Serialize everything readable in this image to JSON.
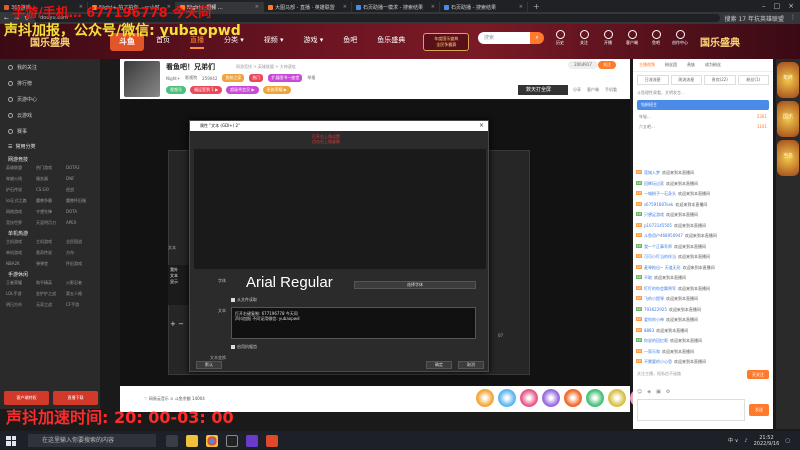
{
  "browser": {
    "tabs": [
      {
        "label": "365游戏…",
        "color": "#e05a2a"
      },
      {
        "label": "Night+ 拍了拍你… 一小时",
        "color": "#ff7a2a"
      },
      {
        "label": "Night+ 视频 …",
        "color": "#ff7a2a",
        "active": true
      },
      {
        "label": "大图马部 - 直播 · 英雄联盟",
        "color": "#ff7a2a"
      },
      {
        "label": "石页助播一模求 - 搜索结果",
        "color": "#4a8be8"
      },
      {
        "label": "石页助播 - 搜索结果",
        "color": "#4a8be8"
      }
    ],
    "plus": "+",
    "address": "douyu.com",
    "search_hint": "搜索 17 年抗英雄联盟"
  },
  "overlays": {
    "line1": "手游/手机…  677196778  今天同",
    "line2": "声抖加报，公众号/微信:  yubaopwd",
    "timer": "声抖加速时间: 20: 00-03: 00"
  },
  "site": {
    "logo": "斗鱼",
    "festival": "国乐盛典",
    "nav": [
      {
        "label": "首页"
      },
      {
        "label": "直播",
        "active": true
      },
      {
        "label": "分类 ▾"
      },
      {
        "label": "视频 ▾"
      },
      {
        "label": "游戏 ▾"
      },
      {
        "label": "鱼吧"
      },
      {
        "label": "鱼乐盛典"
      }
    ],
    "badge_line1": "年度国乐盛典",
    "badge_line2": "全民争霸赛",
    "search_placeholder": "搜索",
    "icons": [
      {
        "label": "历史"
      },
      {
        "label": "关注"
      },
      {
        "label": "开播"
      },
      {
        "label": "客户端"
      },
      {
        "label": "鱼吧"
      },
      {
        "label": "创作中心"
      }
    ]
  },
  "sidebar": {
    "items": [
      {
        "label": "我的关注"
      },
      {
        "label": "排行榜"
      },
      {
        "label": "页游中心"
      },
      {
        "label": "云游戏"
      },
      {
        "label": "赛事"
      }
    ],
    "section_common": "常用分类",
    "section_online": "网游竞技",
    "online_grid": [
      "英雄联盟",
      "热门游戏",
      "DOTA2",
      "穿越火线",
      "服务器",
      "DNF",
      "炉石传说",
      "CS:GO",
      "逆战",
      "lol正式之路",
      "魔兽争霸",
      "魔兽怀旧服",
      "网络游戏",
      "守望先锋",
      "DOTA",
      "竞技世界",
      "天涯明月刀",
      "APEX"
    ],
    "section_single": "单机热游",
    "single_grid": [
      "主机游戏",
      "主机游戏",
      "全民国战",
      "单机游戏",
      "奥奇传说",
      "方舟",
      "NBA2K",
      "弹弹堂",
      "怀旧游戏"
    ],
    "section_mobile": "手游休闲",
    "mobile_grid": [
      "王者荣耀",
      "和平精英",
      "火影忍者",
      "LOL手游",
      "金铲铲之战",
      "第五人格",
      "明日方舟",
      "无双之战",
      "CF手游"
    ],
    "promo": [
      "客户端特权",
      "直播下载"
    ]
  },
  "room": {
    "title": "看鱼吧！兄弟们",
    "categories": "网游竞技 > 英雄联盟 > 大神速攻",
    "streamer": "Night+",
    "streamer_tag": "影视院",
    "fans": "259042",
    "tag1": "鱼粉之家",
    "tag2": "热门",
    "tag3": "扩展图书一座堂",
    "report": "举报",
    "badges": [
      "视频号",
      "福运签到 1 ▶",
      "超级秀会员 ▶",
      "贵族荣耀 ▶"
    ],
    "pop": "2064917",
    "follow": "关注",
    "download": "数天打全屏",
    "actions": [
      "分享",
      "客户端",
      "手机看"
    ]
  },
  "obs": {
    "text_label": "文本",
    "list": [
      "我外",
      "文本",
      "显示"
    ],
    "footnote": "07"
  },
  "dialog": {
    "title": "属性 \"文本 (GDI+) 2\"",
    "red_line1": "打开右上角设置",
    "red_line2": "点击右上角复制",
    "font_label": "字体",
    "font_name": "Arial Regular",
    "font_button": "选择字体",
    "read_file": "从文件读取",
    "text_label": "文本",
    "text_lines": [
      "打开右键复制: 677196778  今天同",
      "声抖加报  不同证用微信: yubaopwd"
    ],
    "antialias": "启用抗锯齿",
    "transform": "文本变换",
    "defaults_btn": "默认",
    "ok_btn": "确定",
    "cancel_btn": "取消"
  },
  "giftbar": {
    "left": "♡ 网易云音乐  ⊙ 斗鱼余额 14004",
    "gift_colors": [
      "#f1a83b",
      "#5cb6f0",
      "#e85a8a",
      "#9a6ce0",
      "#f16a2b",
      "#4ac07a",
      "#d9c04a",
      "#f19ab8"
    ]
  },
  "chat": {
    "head": [
      "主播视频",
      "粉丝团",
      "贵族",
      "成为粉丝"
    ],
    "tabs": [
      "日流流星",
      "周流流星",
      "贵宾(22)",
      "粉丝(1)"
    ],
    "notice": "斗鱼理性观看，文明发言…",
    "fans_title": "钻粉班主",
    "fans_rows": [
      {
        "name": "年轻...",
        "num": "2301"
      },
      {
        "name": "六五吧...",
        "num": "1101"
      }
    ],
    "messages": [
      {
        "lvl": "LV",
        "name": "莲城入梦",
        "text": "欢迎来到本直播间"
      },
      {
        "lvl": "LV",
        "name": "回眸玩过家",
        "text": "欢迎来到本直播间"
      },
      {
        "lvl": "LV",
        "name": "一城粉子一石身头",
        "text": "欢迎来到本直播间"
      },
      {
        "lvl": "LV",
        "name": "s67591687kek",
        "text": "欢迎来到本直播间"
      },
      {
        "lvl": "LV",
        "name": "只想足游戏",
        "text": "欢迎来到本直播间"
      },
      {
        "lvl": "LV",
        "name": "p1073145505",
        "text": "欢迎来到本直播间"
      },
      {
        "lvl": "LV",
        "name": "斗鱼用户468950947",
        "text": "欢迎来到本直播间"
      },
      {
        "lvl": "LV",
        "name": "我一个正事军师",
        "text": "欢迎来到本直播间"
      },
      {
        "lvl": "LV",
        "name": "可可小叮当的伴当",
        "text": "欢迎来到本直播间"
      },
      {
        "lvl": "LV",
        "name": "麦琴枪出~ 天道无形",
        "text": "欢迎来到本直播间"
      },
      {
        "lvl": "LV",
        "name": "不取",
        "text": "欢迎来到本直播间"
      },
      {
        "lvl": "LV",
        "name": "叮叮的你会舞将军",
        "text": "欢迎来到本直播间"
      },
      {
        "lvl": "LV",
        "name": "飞的小提琴",
        "text": "欢迎来到本直播间"
      },
      {
        "lvl": "LV",
        "name": "793622925",
        "text": "欢迎来到本直播间"
      },
      {
        "lvl": "LV",
        "name": "爱你的小神",
        "text": "欢迎来到本直播间"
      },
      {
        "lvl": "LV",
        "name": "8883",
        "text": "欢迎来到本直播间"
      },
      {
        "lvl": "LV",
        "name": "你说的回忆呢",
        "text": "欢迎来到本直播间"
      },
      {
        "lvl": "LV",
        "name": "一家乐和",
        "text": "欢迎来到本直播间"
      },
      {
        "lvl": "LV",
        "name": "不需要的小心思",
        "text": "欢迎来到本直播间"
      }
    ],
    "input_hint": "关注主播，抢私信不迷路",
    "follow_btn": "开关注",
    "send_btn": "发送"
  },
  "right_ads": [
    "年终",
    "国乐",
    "当名"
  ],
  "taskbar": {
    "search": "在这里输入你要搜索的内容",
    "tray_text": "中 ∨",
    "time": "21:52",
    "date": "2022/9/16"
  }
}
